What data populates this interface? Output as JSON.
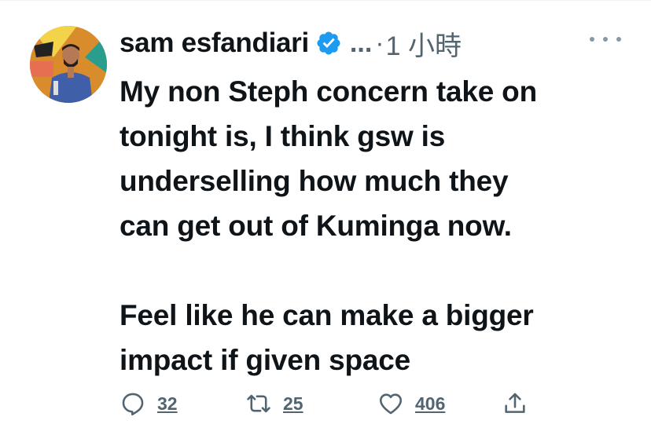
{
  "author": {
    "display_name": "sam esfandiari",
    "handle_truncated": "...",
    "separator": "·",
    "timestamp": "1 小時",
    "verified": true
  },
  "tweet": {
    "paragraph_1": [
      "My non Steph concern take on",
      "tonight is, I think gsw is",
      "underselling how much they",
      "can get out of Kuminga now."
    ],
    "paragraph_2": [
      "Feel like he can make a bigger",
      "impact if given space"
    ]
  },
  "actions": {
    "reply_count": "32",
    "retweet_count": "25",
    "like_count": "406"
  },
  "colors": {
    "verified_badge": "#1d9bf0",
    "secondary_text": "#536471",
    "primary_text": "#0f1419"
  },
  "icons": [
    "verified-badge-icon",
    "more-options-icon",
    "reply-icon",
    "retweet-icon",
    "like-icon",
    "share-icon"
  ]
}
